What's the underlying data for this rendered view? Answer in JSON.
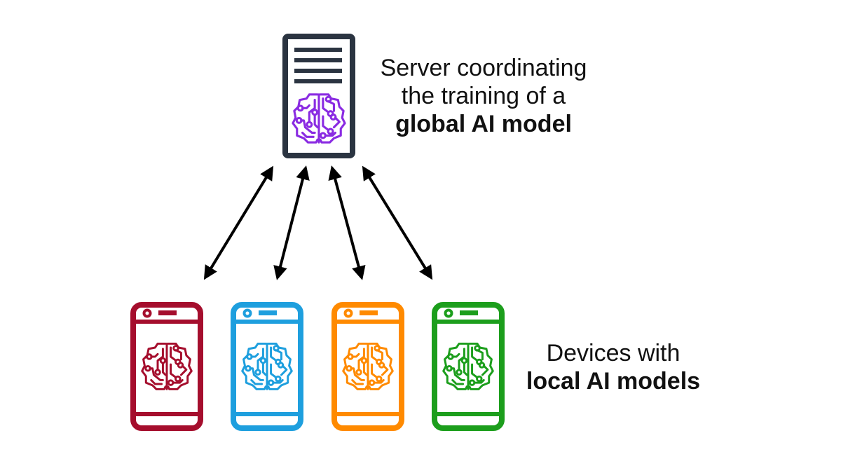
{
  "server": {
    "label_line1": "Server coordinating",
    "label_line2": "the training of a",
    "label_line3": "global AI model",
    "icon": "server-icon",
    "brain_icon": "brain-circuit-icon",
    "frame_color": "#2b3441",
    "brain_color": "#8a2be2"
  },
  "devices": {
    "label_line1": "Devices with",
    "label_line2": "local AI models",
    "icon": "smartphone-icon",
    "brain_icon": "brain-circuit-icon",
    "items": [
      {
        "name": "red",
        "color": "#a50e2d"
      },
      {
        "name": "blue",
        "color": "#1e9fde"
      },
      {
        "name": "orange",
        "color": "#ff8a00"
      },
      {
        "name": "green",
        "color": "#1c9e1c"
      }
    ]
  },
  "arrow_color": "#000000"
}
